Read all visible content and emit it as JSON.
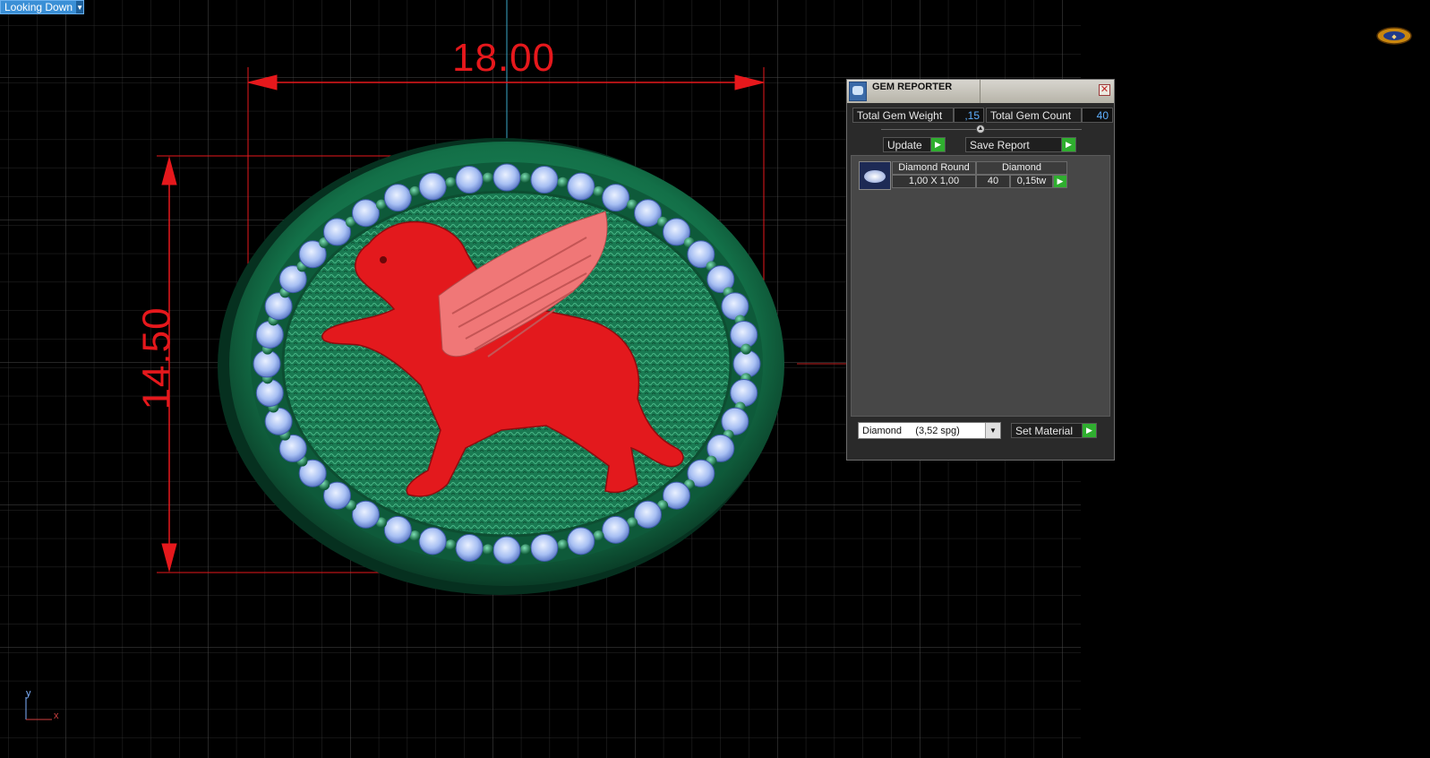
{
  "viewport": {
    "view_label": "Looking Down",
    "dimension_width": "18.00",
    "dimension_height": "14.50",
    "axis_y": "y",
    "axis_x": "x"
  },
  "gem_reporter": {
    "title": "GEM REPORTER",
    "close_icon": "close-icon",
    "total_gem_weight_label": "Total Gem Weight",
    "total_gem_weight_value": ",15",
    "total_gem_count_label": "Total Gem Count",
    "total_gem_count_value": "40",
    "update_label": "Update",
    "save_report_label": "Save Report",
    "gems": [
      {
        "shape": "Diamond Round",
        "material": "Diamond",
        "size": "1,00 X 1,00",
        "count": "40",
        "weight": "0,15tw"
      }
    ],
    "material_select_value": "Diamond     (3,52 spg)",
    "set_material_label": "Set Material"
  },
  "colors": {
    "dimension": "#e6181c",
    "gem_green": "#1f8b5c",
    "griffin_red": "#e3191d"
  }
}
